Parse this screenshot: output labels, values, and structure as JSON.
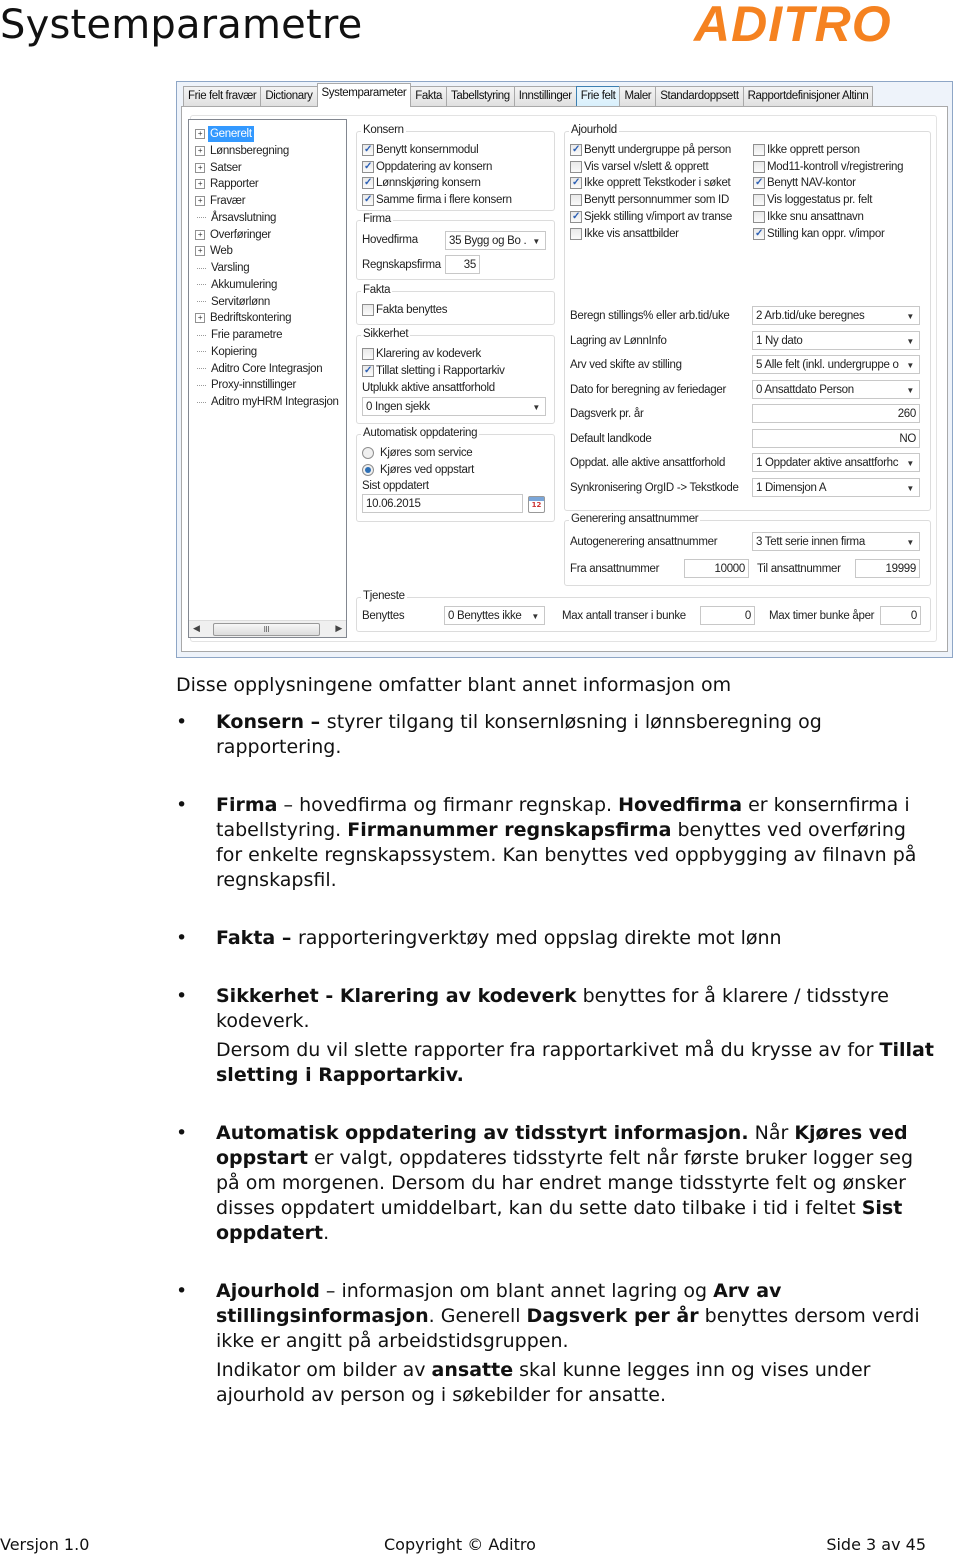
{
  "header": {
    "title": "Systemparametre",
    "logo": "ADITRO",
    "logo_color": "#f58220"
  },
  "window": {
    "tabs": [
      {
        "label": "Frie felt fravær",
        "state": "normal"
      },
      {
        "label": "Dictionary",
        "state": "normal"
      },
      {
        "label": "Systemparameter",
        "state": "active"
      },
      {
        "label": "Fakta",
        "state": "normal"
      },
      {
        "label": "Tabellstyring",
        "state": "normal"
      },
      {
        "label": "Innstillinger",
        "state": "normal"
      },
      {
        "label": "Frie felt",
        "state": "hover"
      },
      {
        "label": "Maler",
        "state": "normal"
      },
      {
        "label": "Standardoppsett",
        "state": "normal"
      },
      {
        "label": "Rapportdefinisjoner Altinn",
        "state": "normal"
      }
    ],
    "tree": {
      "items": [
        {
          "label": "Generelt",
          "expandable": true,
          "selected": true
        },
        {
          "label": "Lønnsberegning",
          "expandable": true
        },
        {
          "label": "Satser",
          "expandable": true
        },
        {
          "label": "Rapporter",
          "expandable": true
        },
        {
          "label": "Fravær",
          "expandable": true
        },
        {
          "label": "Årsavslutning",
          "expandable": false
        },
        {
          "label": "Overføringer",
          "expandable": true
        },
        {
          "label": "Web",
          "expandable": true
        },
        {
          "label": "Varsling",
          "expandable": false
        },
        {
          "label": "Akkumulering",
          "expandable": false
        },
        {
          "label": "Servitørlønn",
          "expandable": false
        },
        {
          "label": "Bedriftskontering",
          "expandable": true
        },
        {
          "label": "Frie parametre",
          "expandable": false
        },
        {
          "label": "Kopiering",
          "expandable": false
        },
        {
          "label": "Aditro Core Integrasjon",
          "expandable": false
        },
        {
          "label": "Proxy-innstillinger",
          "expandable": false
        },
        {
          "label": "Aditro myHRM Integrasjon",
          "expandable": false
        }
      ],
      "scroll_thumb_glyph": "III"
    },
    "konsern": {
      "title": "Konsern",
      "checkboxes": [
        {
          "label": "Benytt konsernmodul",
          "checked": true
        },
        {
          "label": "Oppdatering av konsern",
          "checked": true
        },
        {
          "label": "Lønnskjøring konsern",
          "checked": true
        },
        {
          "label": "Samme firma i flere konsern",
          "checked": true
        }
      ]
    },
    "firma": {
      "title": "Firma",
      "hovedfirma_label": "Hovedfirma",
      "hovedfirma_value": "35 Bygg og Bo .",
      "regnskapsfirma_label": "Regnskapsfirma",
      "regnskapsfirma_value": "35"
    },
    "fakta": {
      "title": "Fakta",
      "checkboxes": [
        {
          "label": "Fakta benyttes",
          "checked": false
        }
      ]
    },
    "sikkerhet": {
      "title": "Sikkerhet",
      "checkboxes": [
        {
          "label": "Klarering av kodeverk",
          "checked": false
        },
        {
          "label": "Tillat sletting i Rapportarkiv",
          "checked": true
        }
      ],
      "utplukk_label": "Utplukk aktive ansattforhold",
      "utplukk_value": "0 Ingen sjekk"
    },
    "auto": {
      "title": "Automatisk oppdatering",
      "radios": [
        {
          "label": "Kjøres som service",
          "selected": false
        },
        {
          "label": "Kjøres ved oppstart",
          "selected": true
        }
      ],
      "sist_label": "Sist oppdatert",
      "sist_value": "10.06.2015",
      "calendar_day": "12"
    },
    "ajourhold": {
      "title": "Ajourhold",
      "checkboxes_left": [
        {
          "label": "Benytt undergruppe på person",
          "checked": true
        },
        {
          "label": "Vis varsel v/slett & opprett",
          "checked": false
        },
        {
          "label": "Ikke opprett Tekstkoder i søket",
          "checked": true
        },
        {
          "label": "Benytt personnummer som ID",
          "checked": false
        },
        {
          "label": "Sjekk stilling v/import av transe",
          "checked": true
        },
        {
          "label": "Ikke vis ansattbilder",
          "checked": false
        }
      ],
      "checkboxes_right": [
        {
          "label": "Ikke opprett person",
          "checked": false
        },
        {
          "label": "Mod11-kontroll v/registrering",
          "checked": false
        },
        {
          "label": "Benytt NAV-kontor",
          "checked": true
        },
        {
          "label": "Vis loggestatus pr. felt",
          "checked": false
        },
        {
          "label": "Ikke snu ansattnavn",
          "checked": false
        },
        {
          "label": "Stilling kan oppr. v/impor",
          "checked": true
        }
      ],
      "fields": [
        {
          "label": "Beregn stillings% eller arb.tid/uke",
          "value": "2 Arb.tid/uke beregnes",
          "type": "select"
        },
        {
          "label": "Lagring av LønnInfo",
          "value": "1 Ny dato",
          "type": "select"
        },
        {
          "label": "Arv ved skifte av stilling",
          "value": "5 Alle felt (inkl. undergruppe o",
          "type": "select"
        },
        {
          "label": "Dato for beregning av feriedager",
          "value": "0 Ansattdato Person",
          "type": "select"
        },
        {
          "label": "Dagsverk pr. år",
          "value": "260",
          "type": "input"
        },
        {
          "label": "Default landkode",
          "value": "NO",
          "type": "input"
        },
        {
          "label": "Oppdat. alle aktive ansattforhold",
          "value": "1 Oppdater aktive ansattforhc",
          "type": "select"
        },
        {
          "label": "Synkronisering OrgID -> Tekstkode",
          "value": "1 Dimensjon A",
          "type": "select"
        }
      ]
    },
    "generering": {
      "title": "Generering ansattnummer",
      "auto_label": "Autogenerering ansattnummer",
      "auto_value": "3 Tett serie innen firma",
      "fra_label": "Fra ansattnummer",
      "fra_value": "10000",
      "til_label": "Til ansattnummer",
      "til_value": "19999"
    },
    "tjeneste": {
      "title": "Tjeneste",
      "benyttes_label": "Benyttes",
      "benyttes_value": "0 Benyttes ikke",
      "max_transer_label": "Max antall transer i bunke",
      "max_transer_value": "0",
      "max_timer_label": "Max timer bunke åper",
      "max_timer_value": "0"
    }
  },
  "body": {
    "intro": "Disse opplysningene omfatter blant annet informasjon om",
    "bullets": [
      {
        "paragraphs": [
          [
            {
              "t": "Konsern – ",
              "b": true
            },
            {
              "t": "styrer tilgang til konsernløsning i lønnsberegning og rapportering.",
              "b": false
            }
          ]
        ]
      },
      {
        "paragraphs": [
          [
            {
              "t": "Firma",
              "b": true
            },
            {
              "t": " – hovedfirma og firmanr regnskap. ",
              "b": false
            },
            {
              "t": "Hovedfirma",
              "b": true
            },
            {
              "t": " er konsernfirma i tabellstyring. ",
              "b": false
            },
            {
              "t": "Firmanummer regnskapsfirma",
              "b": true
            },
            {
              "t": " benyttes ved overføring for enkelte regnskapssystem. Kan benyttes ved oppbygging av filnavn på regnskapsfil.",
              "b": false
            }
          ]
        ]
      },
      {
        "paragraphs": [
          [
            {
              "t": "Fakta – ",
              "b": true
            },
            {
              "t": "rapporteringverktøy med oppslag direkte mot lønn",
              "b": false
            }
          ]
        ]
      },
      {
        "paragraphs": [
          [
            {
              "t": "Sikkerhet - Klarering av kodeverk",
              "b": true
            },
            {
              "t": " benyttes for å klarere / tidsstyre kodeverk.",
              "b": false
            }
          ],
          [
            {
              "t": "Dersom du vil slette rapporter fra rapportarkivet må du krysse av for ",
              "b": false
            },
            {
              "t": "Tillat sletting i Rapportarkiv.",
              "b": true
            }
          ]
        ]
      },
      {
        "paragraphs": [
          [
            {
              "t": "Automatisk oppdatering av tidsstyrt informasjon.",
              "b": true
            },
            {
              "t": " Når ",
              "b": false
            },
            {
              "t": "Kjøres ved oppstart",
              "b": true
            },
            {
              "t": " er valgt, oppdateres tidsstyrte felt når første bruker logger seg på om morgenen. Dersom du har endret mange tidsstyrte felt og ønsker disses oppdatert umiddelbart, kan du sette dato tilbake i tid i feltet ",
              "b": false
            },
            {
              "t": "Sist oppdatert",
              "b": true
            },
            {
              "t": ".",
              "b": false
            }
          ]
        ]
      },
      {
        "paragraphs": [
          [
            {
              "t": "Ajourhold",
              "b": true
            },
            {
              "t": " – informasjon om blant annet lagring og ",
              "b": false
            },
            {
              "t": "Arv av stillingsinformasjon",
              "b": true
            },
            {
              "t": ". Generell ",
              "b": false
            },
            {
              "t": "Dagsverk per år",
              "b": true
            },
            {
              "t": " benyttes dersom verdi ikke er angitt på arbeidstidsgruppen.",
              "b": false
            }
          ],
          [
            {
              "t": "Indikator om bilder av ",
              "b": false
            },
            {
              "t": "ansatte",
              "b": true
            },
            {
              "t": " skal kunne legges inn og vises under ajourhold av person og i søkebilder for ansatte.",
              "b": false
            }
          ]
        ]
      }
    ],
    "bullet_glyph": "•"
  },
  "footer": {
    "version": "Versjon 1.0",
    "copyright": "Copyright © Aditro",
    "page": "Side 3 av 45"
  }
}
